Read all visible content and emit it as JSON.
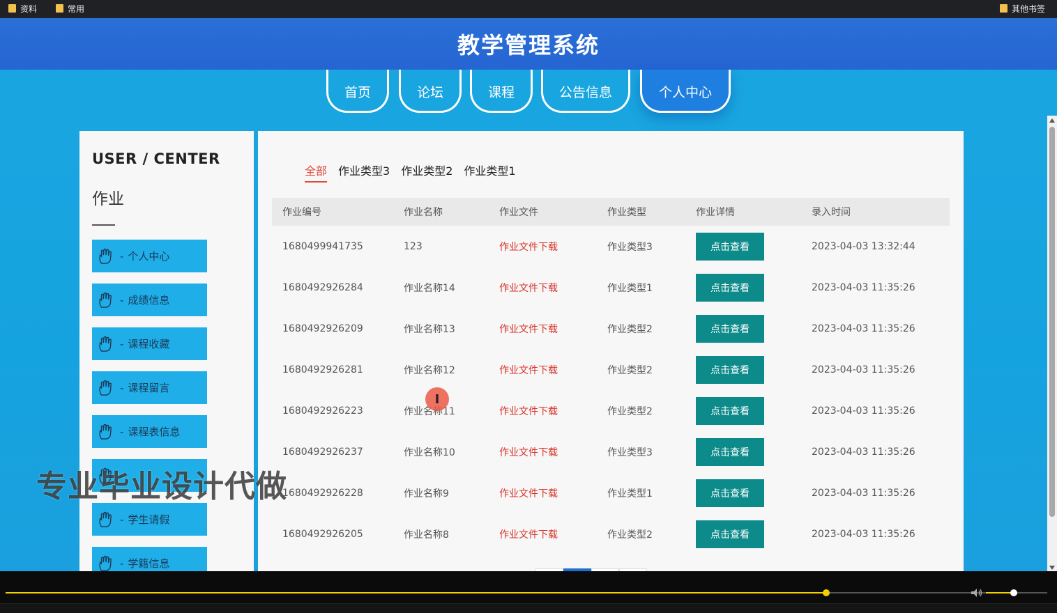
{
  "bookmarks": {
    "left": [
      "资料",
      "常用"
    ],
    "right": "其他书签"
  },
  "site_title": "教学管理系统",
  "nav": [
    {
      "label": "首页"
    },
    {
      "label": "论坛"
    },
    {
      "label": "课程"
    },
    {
      "label": "公告信息"
    },
    {
      "label": "个人中心",
      "active": true
    }
  ],
  "sidebar": {
    "title": "USER / CENTER",
    "section": "作业",
    "items": [
      {
        "label": "个人中心"
      },
      {
        "label": "成绩信息"
      },
      {
        "label": "课程收藏"
      },
      {
        "label": "课程留言"
      },
      {
        "label": "课程表信息"
      },
      {
        "label": ""
      },
      {
        "label": "学生请假"
      },
      {
        "label": "学籍信息"
      }
    ]
  },
  "tabs": [
    "全部",
    "作业类型3",
    "作业类型2",
    "作业类型1"
  ],
  "table": {
    "headers": [
      "作业编号",
      "作业名称",
      "作业文件",
      "作业类型",
      "作业详情",
      "录入时间"
    ],
    "rows": [
      {
        "id": "1680499941735",
        "name": "123",
        "file": "作业文件下载",
        "type": "作业类型3",
        "detail": "点击查看",
        "time": "2023-04-03 13:32:44"
      },
      {
        "id": "1680492926284",
        "name": "作业名称14",
        "file": "作业文件下载",
        "type": "作业类型1",
        "detail": "点击查看",
        "time": "2023-04-03 11:35:26"
      },
      {
        "id": "1680492926209",
        "name": "作业名称13",
        "file": "作业文件下载",
        "type": "作业类型2",
        "detail": "点击查看",
        "time": "2023-04-03 11:35:26"
      },
      {
        "id": "1680492926281",
        "name": "作业名称12",
        "file": "作业文件下载",
        "type": "作业类型2",
        "detail": "点击查看",
        "time": "2023-04-03 11:35:26"
      },
      {
        "id": "1680492926223",
        "name": "作业名称11",
        "file": "作业文件下载",
        "type": "作业类型2",
        "detail": "点击查看",
        "time": "2023-04-03 11:35:26"
      },
      {
        "id": "1680492926237",
        "name": "作业名称10",
        "file": "作业文件下载",
        "type": "作业类型3",
        "detail": "点击查看",
        "time": "2023-04-03 11:35:26"
      },
      {
        "id": "1680492926228",
        "name": "作业名称9",
        "file": "作业文件下载",
        "type": "作业类型1",
        "detail": "点击查看",
        "time": "2023-04-03 11:35:26"
      },
      {
        "id": "1680492926205",
        "name": "作业名称8",
        "file": "作业文件下载",
        "type": "作业类型2",
        "detail": "点击查看",
        "time": "2023-04-03 11:35:26"
      }
    ]
  },
  "watermark": "专业毕业设计代做",
  "player": {
    "progress": 0.79,
    "volume": 0.45
  },
  "colors": {
    "header": "#2565d3",
    "page_bg": "#15a3df",
    "menu_item": "#1faee8",
    "detail_button": "#0d8a8a",
    "file_link": "#d9332a",
    "tab_active": "#e0483a",
    "progress": "#f5d000"
  },
  "icons": {
    "folder": "folder-icon",
    "menu": "hand-icon",
    "volume": "volume-icon"
  }
}
